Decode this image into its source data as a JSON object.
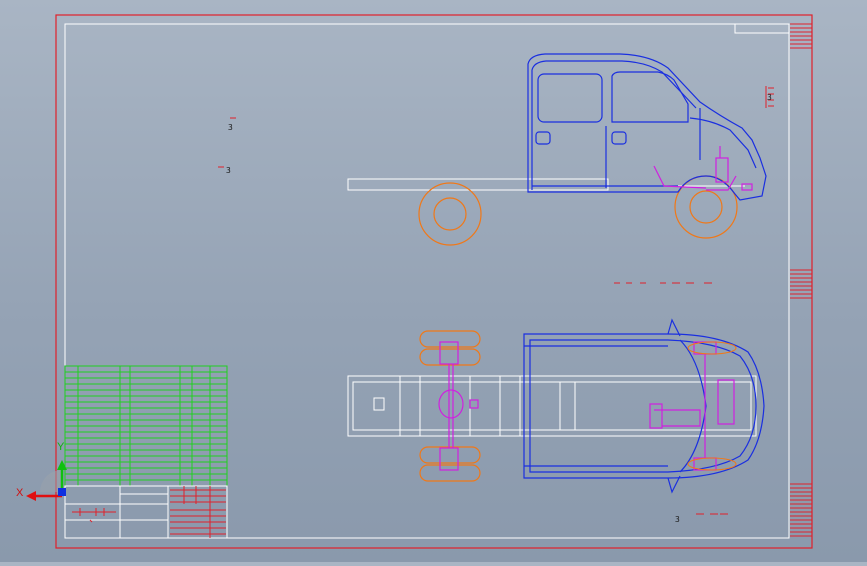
{
  "viewport": {
    "background_top": "#a9b5c4",
    "background_bottom": "#8a99ac",
    "sheet_frame_color": "#e0202a",
    "inner_frame_color": "#ffffff"
  },
  "colors": {
    "body_outline": "#1a2fe0",
    "chassis_frame": "#ffffff",
    "wheel": "#f07818",
    "suspension": "#d020e0",
    "title_block": "#e0202a",
    "parts_list": "#20d020"
  },
  "annotations": {
    "note_a": "3",
    "note_b": "3",
    "note_c": "3",
    "note_d": "3"
  },
  "axis": {
    "x_label": "X",
    "y_label": "Y",
    "x_color": "#e01010",
    "y_color": "#10c010",
    "z_color": "#1030e0"
  },
  "icons": {
    "triad": "axis-triad-icon"
  }
}
